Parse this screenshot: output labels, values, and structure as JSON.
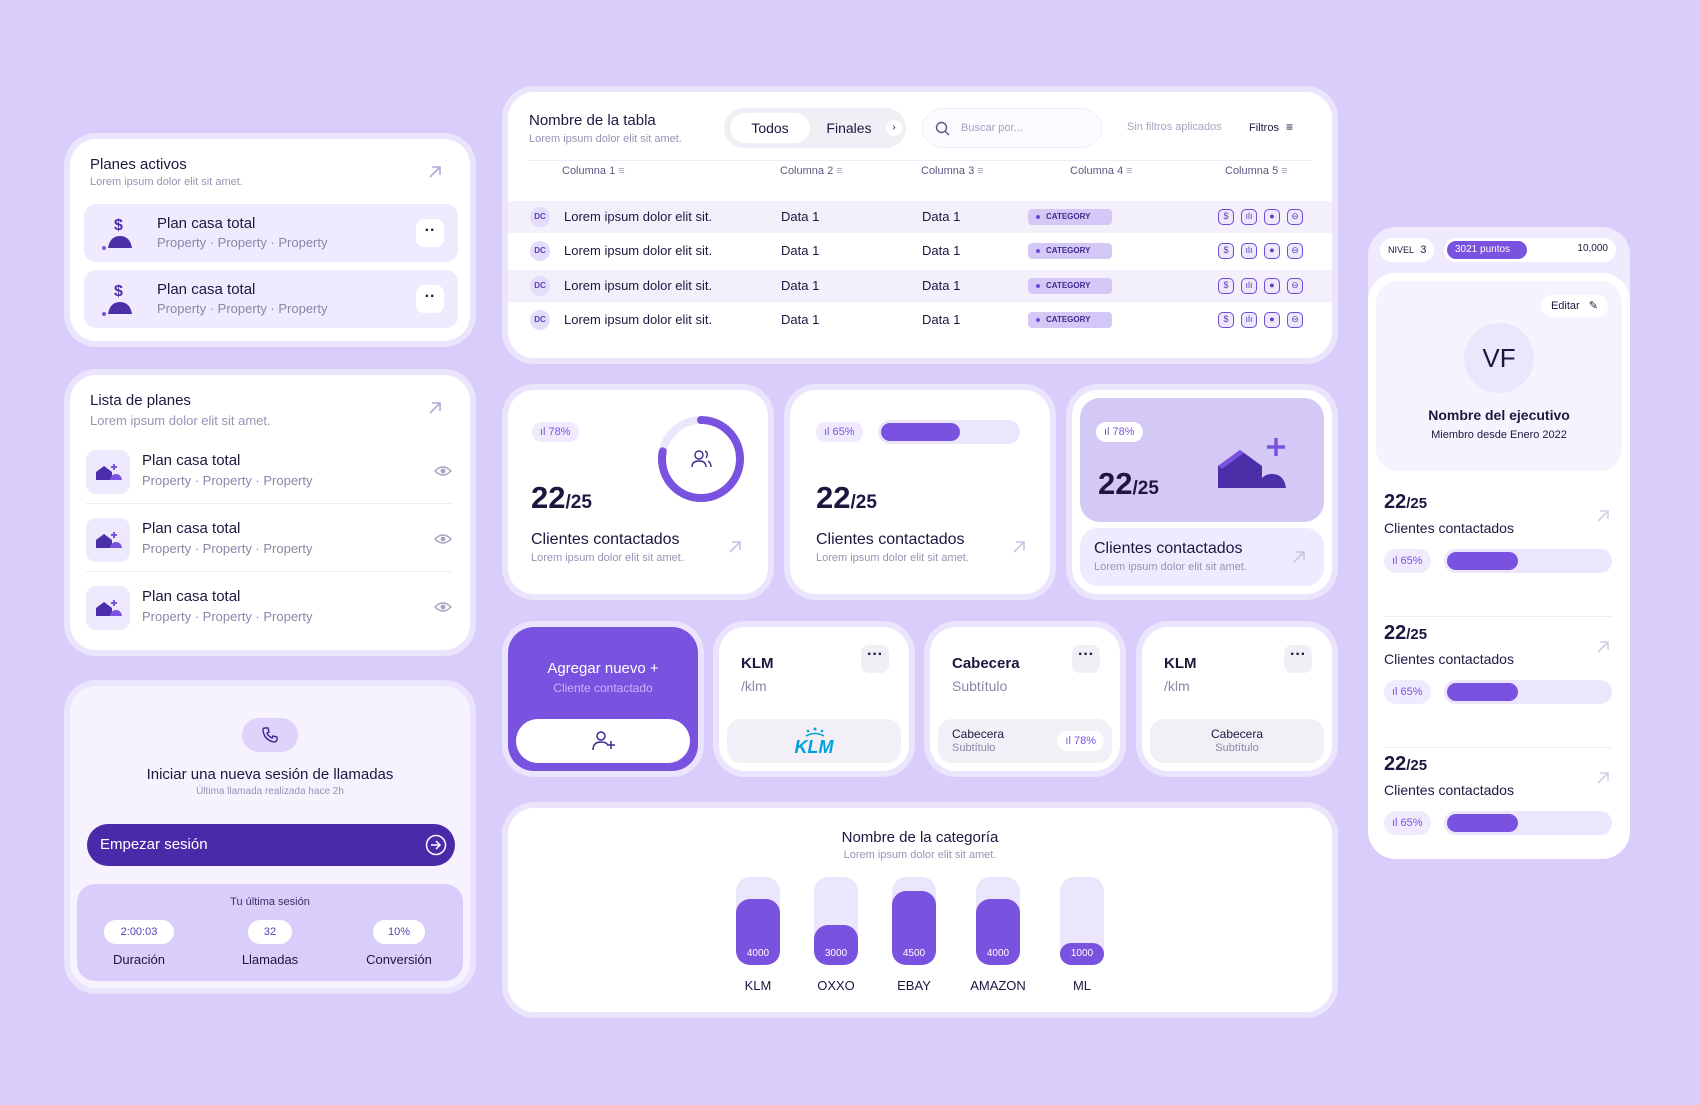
{
  "planes_activos": {
    "title": "Planes activos",
    "subtitle": "Lorem ipsum dolor elit sit amet.",
    "items": [
      {
        "name": "Plan casa total",
        "props": "Property · Property · Property"
      },
      {
        "name": "Plan casa total",
        "props": "Property · Property · Property"
      }
    ]
  },
  "lista_planes": {
    "title": "Lista de planes",
    "subtitle": "Lorem ipsum dolor elit sit amet.",
    "items": [
      {
        "name": "Plan casa total",
        "props": "Property · Property · Property"
      },
      {
        "name": "Plan casa total",
        "props": "Property · Property · Property"
      },
      {
        "name": "Plan casa total",
        "props": "Property · Property · Property"
      }
    ]
  },
  "llamadas": {
    "title": "Iniciar una nueva sesión de llamadas",
    "subtitle": "Última llamada realizada hace 2h",
    "button": "Empezar sesión",
    "last_session": "Tu última sesión",
    "stats": [
      {
        "value": "2:00:03",
        "label": "Duración"
      },
      {
        "value": "32",
        "label": "Llamadas"
      },
      {
        "value": "10%",
        "label": "Conversión"
      }
    ]
  },
  "table": {
    "title": "Nombre de la tabla",
    "subtitle": "Lorem ipsum dolor elit sit amet.",
    "tabs": [
      "Todos",
      "Finales"
    ],
    "search_placeholder": "Buscar por...",
    "filters_status": "Sin filtros aplicados",
    "filters_label": "Filtros",
    "columns": [
      "Columna 1",
      "Columna 2",
      "Columna 3",
      "Columna 4",
      "Columna 5"
    ],
    "rows": [
      {
        "avatar": "DC",
        "c1": "Lorem ipsum dolor elit sit.",
        "c2": "Data 1",
        "c3": "Data 1",
        "c4": "CATEGORY"
      },
      {
        "avatar": "DC",
        "c1": "Lorem ipsum dolor elit sit.",
        "c2": "Data 1",
        "c3": "Data 1",
        "c4": "CATEGORY"
      },
      {
        "avatar": "DC",
        "c1": "Lorem ipsum dolor elit sit.",
        "c2": "Data 1",
        "c3": "Data 1",
        "c4": "CATEGORY"
      },
      {
        "avatar": "DC",
        "c1": "Lorem ipsum dolor elit sit.",
        "c2": "Data 1",
        "c3": "Data 1",
        "c4": "CATEGORY"
      }
    ],
    "row_icons": [
      "$",
      "📊",
      "●",
      "🚗"
    ]
  },
  "stats": [
    {
      "pill": "ıl 78%",
      "value": "22",
      "total": "/25",
      "label": "Clientes contactados",
      "sub": "Lorem ipsum dolor elit sit amet.",
      "progress": 0.78
    },
    {
      "pill": "ıl 65%",
      "value": "22",
      "total": "/25",
      "label": "Clientes contactados",
      "sub": "Lorem ipsum dolor elit sit amet.",
      "progress": 0.65
    },
    {
      "pill": "ıl 78%",
      "value": "22",
      "total": "/25",
      "label": "Clientes contactados",
      "sub": "Lorem ipsum dolor elit sit amet."
    }
  ],
  "add_card": {
    "title": "Agregar nuevo +",
    "subtitle": "Cliente contactado"
  },
  "mini_cards": [
    {
      "title": "KLM",
      "subtitle": "/klm",
      "logo": "KLM"
    },
    {
      "title": "Cabecera",
      "subtitle": "Subtítulo",
      "inner_title": "Cabecera",
      "inner_sub": "Subtítulo",
      "pill": "ıl 78%"
    },
    {
      "title": "KLM",
      "subtitle": "/klm",
      "inner_title": "Cabecera",
      "inner_sub": "Subtítulo"
    }
  ],
  "chart_data": {
    "type": "bar",
    "title": "Nombre de la categoría",
    "subtitle": "Lorem ipsum dolor elit sit amet.",
    "categories": [
      "KLM",
      "OXXO",
      "EBAY",
      "AMAZON",
      "ML"
    ],
    "values": [
      4000,
      3000,
      4500,
      4000,
      1000
    ],
    "ylim": [
      0,
      5000
    ]
  },
  "profile": {
    "level_label": "NIVEL",
    "level": "3",
    "points": "3021 puntos",
    "points_max": "10,000",
    "points_progress": 0.3021,
    "edit": "Editar",
    "initials": "VF",
    "name": "Nombre del ejecutivo",
    "since": "Miembro desde Enero 2022",
    "items": [
      {
        "value": "22",
        "total": "/25",
        "label": "Clientes contactados",
        "pill": "ıl 65%",
        "progress": 0.65
      },
      {
        "value": "22",
        "total": "/25",
        "label": "Clientes contactados",
        "pill": "ıl 65%",
        "progress": 0.65
      },
      {
        "value": "22",
        "total": "/25",
        "label": "Clientes contactados",
        "pill": "ıl 65%",
        "progress": 0.65
      }
    ]
  }
}
